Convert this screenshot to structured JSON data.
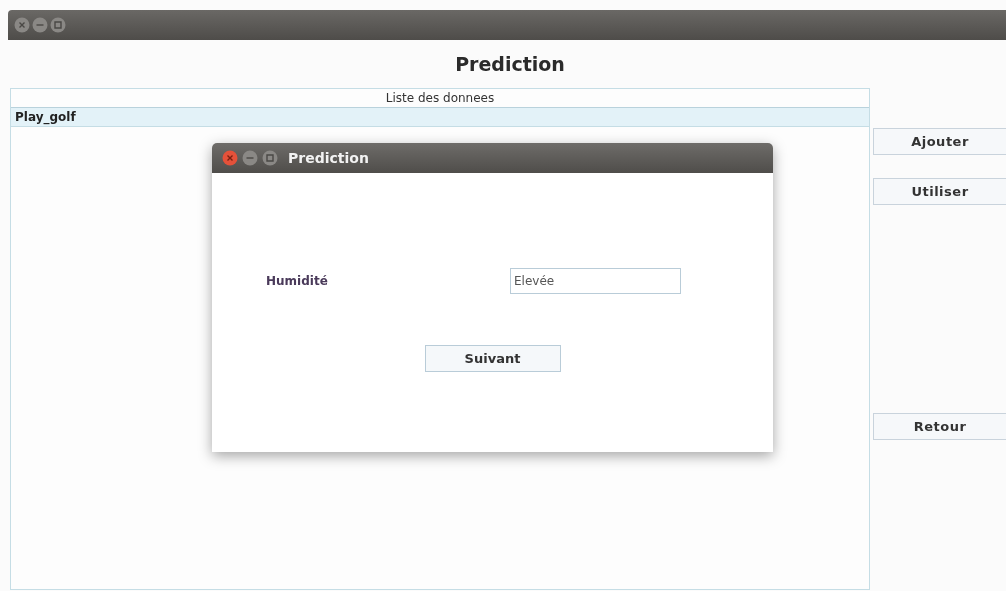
{
  "main_window": {
    "title": "Prediction",
    "table": {
      "header": "Liste des donnees",
      "rows": [
        {
          "cells": [
            "Play_golf"
          ],
          "selected": true
        }
      ]
    },
    "buttons": [
      "Ajouter",
      "Utiliser",
      "Retour"
    ]
  },
  "dialog": {
    "title": "Prediction",
    "fields": [
      {
        "label": "Humidité",
        "value": "Elevée"
      }
    ],
    "buttons": [
      "Suivant"
    ]
  }
}
